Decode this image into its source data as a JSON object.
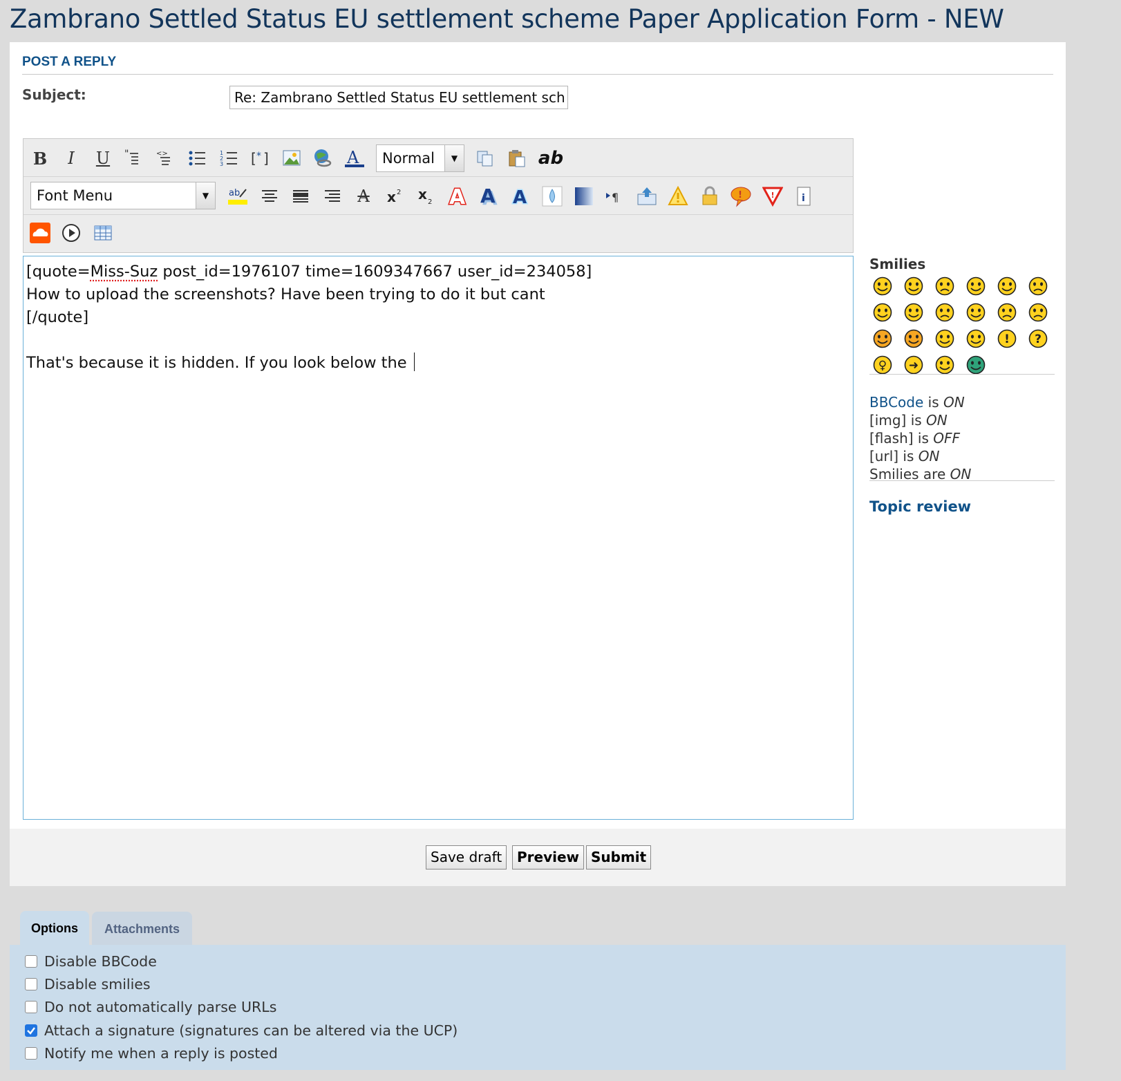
{
  "page_title": "Zambrano Settled Status EU settlement scheme Paper Application Form - NEW",
  "panel": {
    "heading": "POST A REPLY",
    "subject_label": "Subject:",
    "subject_value": "Re: Zambrano Settled Status EU settlement sch"
  },
  "toolbar": {
    "size_select": "Normal",
    "font_menu": "Font Menu",
    "spell_label": "ab",
    "row1_icons": [
      "bold-icon",
      "italic-icon",
      "underline-icon",
      "quote-icon",
      "code-icon",
      "bullet-list-icon",
      "numbered-list-icon",
      "list-item-icon",
      "image-icon",
      "link-icon",
      "font-color-icon"
    ],
    "row1_right_icons": [
      "copy-icon",
      "paste-icon",
      "spellcheck-icon"
    ],
    "row2_icons": [
      "highlight-icon",
      "align-center-icon",
      "align-justify-icon",
      "align-right-icon",
      "strikethrough-icon",
      "superscript-icon",
      "subscript-icon",
      "outline-text-icon",
      "shadow-text-icon",
      "glow-text-icon",
      "drop-icon",
      "gradient-icon",
      "direction-icon",
      "upload-icon",
      "warning-icon",
      "lock-icon",
      "speech-bubble-icon",
      "red-triangle-icon",
      "info-document-icon"
    ],
    "row3_icons": [
      "soundcloud-icon",
      "play-icon",
      "table-icon"
    ]
  },
  "editor": {
    "lines": [
      "[quote=Miss-Suz post_id=1976107 time=1609347667 user_id=234058]",
      "How to upload the screenshots? Have been trying to do it but cant",
      "[/quote]",
      "",
      "That's because it is hidden. If you look below the "
    ],
    "line1_prefix": "[quote=",
    "line1_misspelled": "Miss-Suz",
    "line1_suffix": " post_id=1976107 time=1609347667 user_id=234058]"
  },
  "sidebar": {
    "smilies_title": "Smilies",
    "smilies": [
      "very-happy-smiley",
      "smile-smiley",
      "sad-smiley",
      "surprised-smiley",
      "shocked-smiley",
      "confused-smiley",
      "cool-smiley",
      "laughing-smiley",
      "mad-smiley",
      "razz-smiley",
      "embarrassed-smiley",
      "crying-smiley",
      "evil-smiley",
      "twisted-evil-smiley",
      "rolling-eyes-smiley",
      "wink-smiley",
      "exclamation-smiley",
      "question-smiley",
      "idea-smiley",
      "arrow-smiley",
      "neutral-smiley",
      "mr-green-smiley"
    ],
    "bbcode_link": "BBCode",
    "bbcode_is": " is ",
    "bbcode_state": "ON",
    "img_label": "[img] is ",
    "img_state": "ON",
    "flash_label": "[flash] is ",
    "flash_state": "OFF",
    "url_label": "[url] is ",
    "url_state": "ON",
    "smilies_label": "Smilies are ",
    "smilies_state": "ON",
    "topic_review": "Topic review"
  },
  "buttons": {
    "save_draft": "Save draft",
    "preview": "Preview",
    "submit": "Submit"
  },
  "tabs": {
    "options": "Options",
    "attachments": "Attachments"
  },
  "options": [
    {
      "label": "Disable BBCode",
      "checked": false
    },
    {
      "label": "Disable smilies",
      "checked": false
    },
    {
      "label": "Do not automatically parse URLs",
      "checked": false
    },
    {
      "label": "Attach a signature (signatures can be altered via the UCP)",
      "checked": true
    },
    {
      "label": "Notify me when a reply is posted",
      "checked": false
    }
  ],
  "colors": {
    "title": "#12355b",
    "link": "#105289",
    "options_bg": "#cadceb",
    "smiley_yellow": "#ffd21f"
  }
}
